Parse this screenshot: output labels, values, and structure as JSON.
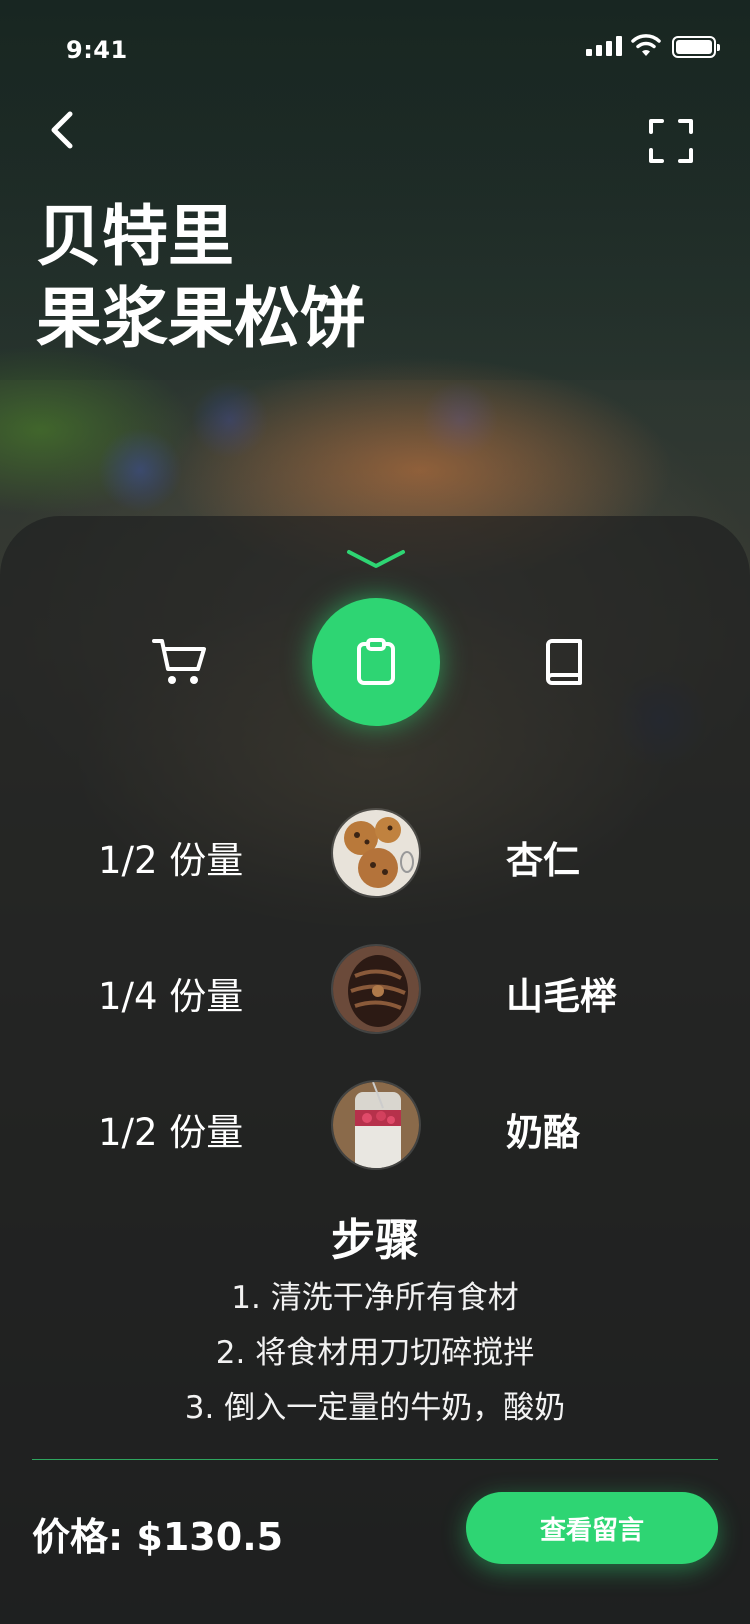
{
  "status_bar": {
    "time": "9:41"
  },
  "header": {
    "title_line1": "贝特里",
    "title_line2": "果浆果松饼",
    "back_icon": "chevron-left-icon",
    "expand_icon": "fullscreen-icon"
  },
  "tabs": [
    {
      "icon": "cart-icon",
      "active": false
    },
    {
      "icon": "clipboard-icon",
      "active": true
    },
    {
      "icon": "book-icon",
      "active": false
    }
  ],
  "ingredients": [
    {
      "quantity": "1/2 份量",
      "name": "杏仁",
      "image": "cookies-photo"
    },
    {
      "quantity": "1/4 份量",
      "name": "山毛榉",
      "image": "pastry-photo"
    },
    {
      "quantity": "1/2 份量",
      "name": "奶酪",
      "image": "yogurt-jar-photo"
    }
  ],
  "steps": {
    "title": "步骤",
    "items": [
      "1. 清洗干净所有食材",
      "2. 将食材用刀切碎搅拌",
      "3. 倒入一定量的牛奶，酸奶"
    ]
  },
  "footer": {
    "price": "价格: $130.5",
    "button_label": "查看留言"
  },
  "colors": {
    "accent": "#2ed573",
    "sheet": "#202121",
    "divider": "#2ea65f"
  }
}
